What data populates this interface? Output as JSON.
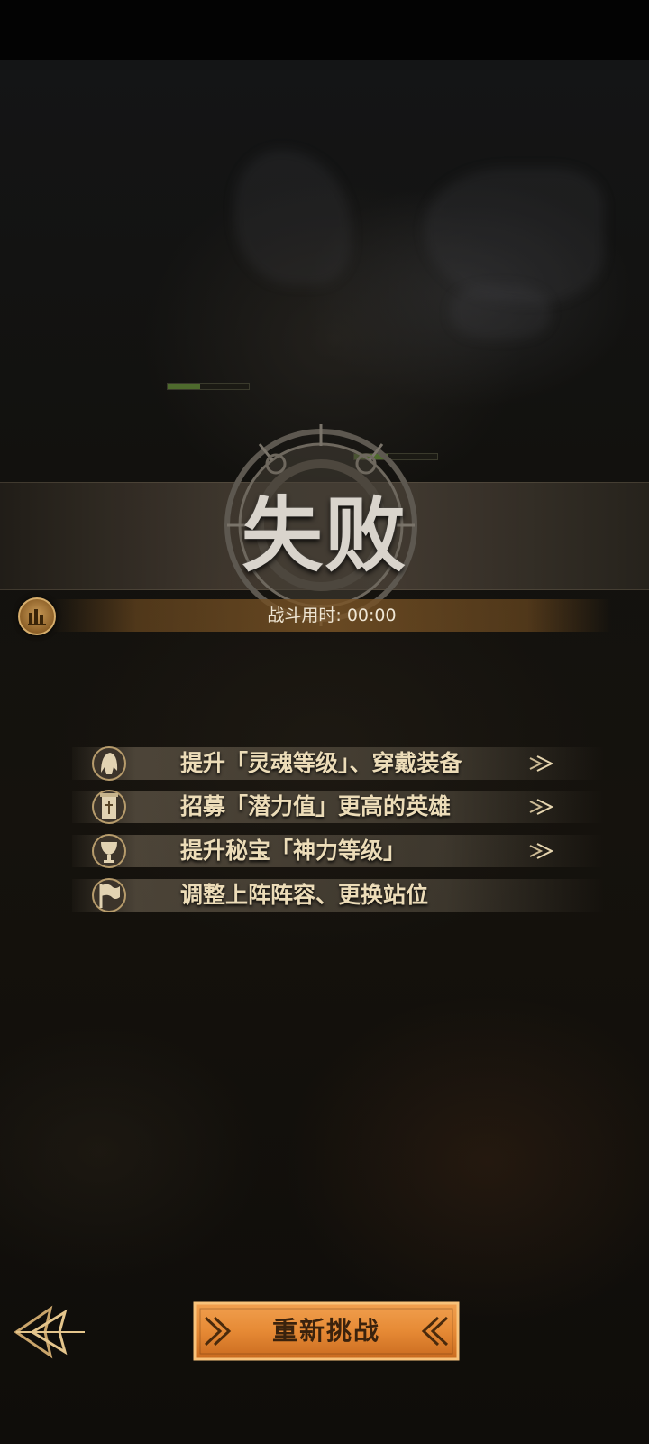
{
  "result": {
    "title": "失败"
  },
  "battle_time": {
    "label": "战斗用时: 00:00"
  },
  "tips": [
    {
      "label": "提升「灵魂等级」、穿戴装备",
      "icon": "helmet-icon",
      "has_arrow": true
    },
    {
      "label": "招募「潜力值」更高的英雄",
      "icon": "recruit-scroll-icon",
      "has_arrow": true
    },
    {
      "label": "提升秘宝「神力等级」",
      "icon": "chalice-icon",
      "has_arrow": true
    },
    {
      "label": "调整上阵阵容、更换站位",
      "icon": "flag-icon",
      "has_arrow": false
    }
  ],
  "buttons": {
    "retry": "重新挑战",
    "back_icon": "back-arrow-icon",
    "stats_icon": "bar-chart-icon"
  },
  "colors": {
    "accent_orange": "#e0893a",
    "tip_text": "#ecdcb8",
    "title_text": "#d9d4cc"
  }
}
